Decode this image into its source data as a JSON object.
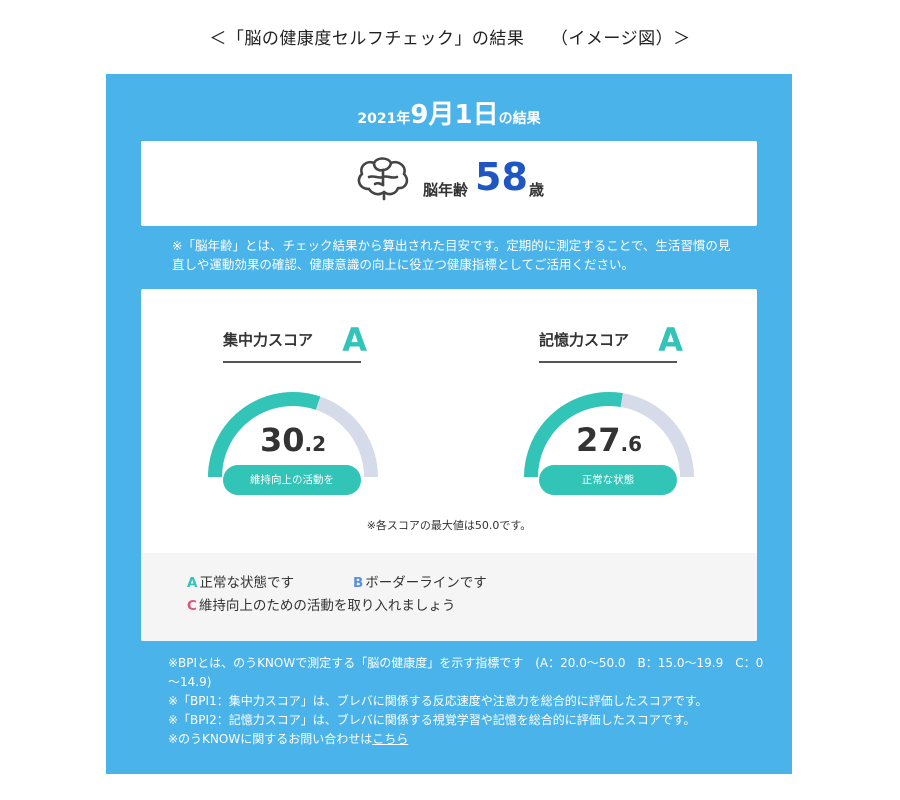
{
  "caption": "＜「脳の健康度セルフチェック」の結果　　（イメージ図）＞",
  "result_header": {
    "year": "2021年",
    "date": "9月1日",
    "suffix": "の結果"
  },
  "brain_age": {
    "label": "脳年齢",
    "value": "58",
    "unit": "歳",
    "icon": "brain-icon"
  },
  "brain_age_note": "※「脳年齢」とは、チェック結果から算出された目安です。定期的に測定することで、生活習慣の見直しや運動効果の確認、健康意識の向上に役立つ健康指標としてご活用ください。",
  "scores": [
    {
      "name": "集中力スコア",
      "grade": "A",
      "value_int": "30",
      "value_dec": ".2",
      "value": 30.2,
      "max": 50.0,
      "status": "維持向上の活動を"
    },
    {
      "name": "記憶力スコア",
      "grade": "A",
      "value_int": "27",
      "value_dec": ".6",
      "value": 27.6,
      "max": 50.0,
      "status": "正常な状態"
    }
  ],
  "max_note": "※各スコアの最大値は50.0です。",
  "legend": {
    "a_letter": "A",
    "a_text": "正常な状態です",
    "b_letter": "B",
    "b_text": "ボーダーラインです",
    "c_letter": "C",
    "c_text": "維持向上のための活動を取り入れましょう"
  },
  "notes": {
    "bpi_definition": "※BPIとは、のうKNOWで測定する「脳の健康度」を示す指標です　(A：20.0～50.0　B：15.0～19.9　C：0～14.9)",
    "bpi1": "※「BPI1：集中力スコア」は、ブレバに関係する反応速度や注意力を総合的に評価したスコアです。",
    "bpi2": "※「BPI2：記憶力スコア」は、ブレバに関係する視覚学習や記憶を総合的に評価したスコアです。",
    "contact_prefix": "※のうKNOWに関するお問い合わせは",
    "contact_link": "こちら"
  },
  "colors": {
    "panel": "#4ab4ea",
    "accent_teal": "#33c4b8",
    "gauge_track": "#d6dbea",
    "age_value": "#1f56c1",
    "grade_a": "#32c3b9",
    "grade_b": "#5b8fe0",
    "grade_c": "#d9577a"
  }
}
